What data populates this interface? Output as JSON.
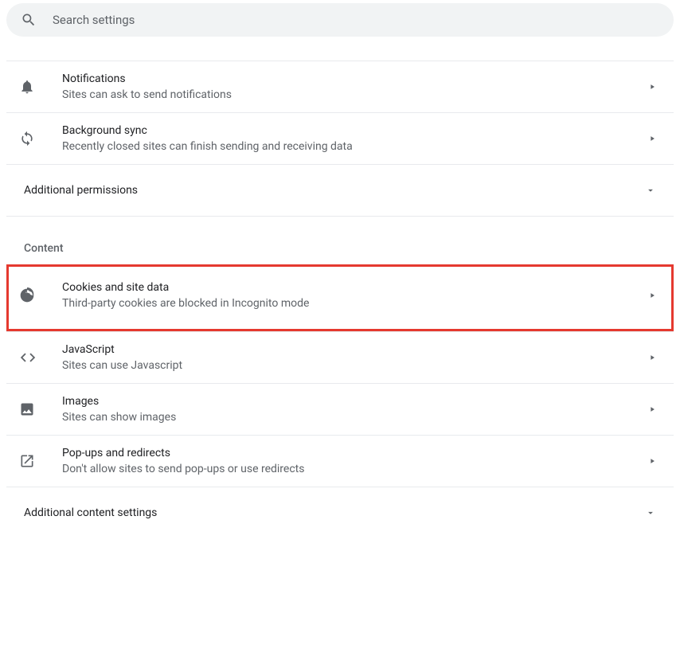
{
  "search": {
    "placeholder": "Search settings"
  },
  "permissions": {
    "notifications": {
      "title": "Notifications",
      "desc": "Sites can ask to send notifications"
    },
    "backgroundSync": {
      "title": "Background sync",
      "desc": "Recently closed sites can finish sending and receiving data"
    },
    "additional": "Additional permissions"
  },
  "content": {
    "header": "Content",
    "cookies": {
      "title": "Cookies and site data",
      "desc": "Third-party cookies are blocked in Incognito mode"
    },
    "javascript": {
      "title": "JavaScript",
      "desc": "Sites can use Javascript"
    },
    "images": {
      "title": "Images",
      "desc": "Sites can show images"
    },
    "popups": {
      "title": "Pop-ups and redirects",
      "desc": "Don't allow sites to send pop-ups or use redirects"
    },
    "additional": "Additional content settings"
  }
}
